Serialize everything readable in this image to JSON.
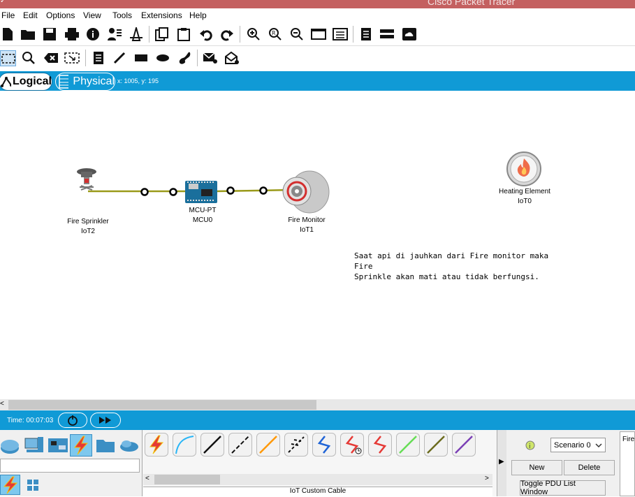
{
  "app": {
    "title": "Cisco Packet Tracer"
  },
  "menu": [
    "File",
    "Edit",
    "Options",
    "View",
    "Tools",
    "Extensions",
    "Help"
  ],
  "toolbar1": [
    "new-file-icon",
    "open-folder-icon",
    "save-icon",
    "print-icon",
    "info-icon",
    "activity-wizard-icon",
    "custom-device-icon",
    "copy-icon",
    "paste-icon",
    "undo-icon",
    "redo-icon",
    "zoom-in-icon",
    "zoom-reset-icon",
    "zoom-out-icon",
    "drawing-palette-icon",
    "custom-devices-dialog-icon",
    "notes-icon",
    "physical-device-icon",
    "cloud-icon"
  ],
  "toolbar2": [
    "select-icon",
    "inspect-icon",
    "delete-icon",
    "resize-icon",
    "note-icon",
    "line-icon",
    "rectangle-icon",
    "ellipse-icon",
    "freeform-icon",
    "simple-pdu-icon",
    "complex-pdu-icon"
  ],
  "modes": {
    "logical": "Logical",
    "physical": "Physical"
  },
  "coords": "x: 1005, y: 195",
  "devices": {
    "sprinkler": {
      "type": "Fire Sprinkler",
      "name": "IoT2"
    },
    "mcu": {
      "type": "MCU-PT",
      "name": "MCU0"
    },
    "monitor": {
      "type": "Fire Monitor",
      "name": "IoT1"
    },
    "heating": {
      "type": "Heating Element",
      "name": "IoT0"
    }
  },
  "note": {
    "line1": "Saat api di jauhkan dari Fire monitor maka Fire",
    "line2": "Sprinkle akan mati atau tidak berfungsi."
  },
  "time": {
    "label": "Time: 00:07:03"
  },
  "cables": {
    "colors": [
      "#e53935",
      "#29b6f6",
      "#111111",
      "#111111",
      "#ff9800",
      "#111111",
      "#1e63d6",
      "#e53935",
      "#e53935",
      "#66dd55",
      "#6b6b1e",
      "#7b3fb5"
    ],
    "selected_label": "IoT Custom Cable"
  },
  "pdu": {
    "scenario": "Scenario 0",
    "new_label": "New",
    "delete_label": "Delete",
    "toggle_label": "Toggle PDU List Window",
    "list_header": "Fire"
  },
  "colors": {
    "accent": "#109ad6",
    "link": "#9a9a1a",
    "titlebar": "#c46060"
  }
}
